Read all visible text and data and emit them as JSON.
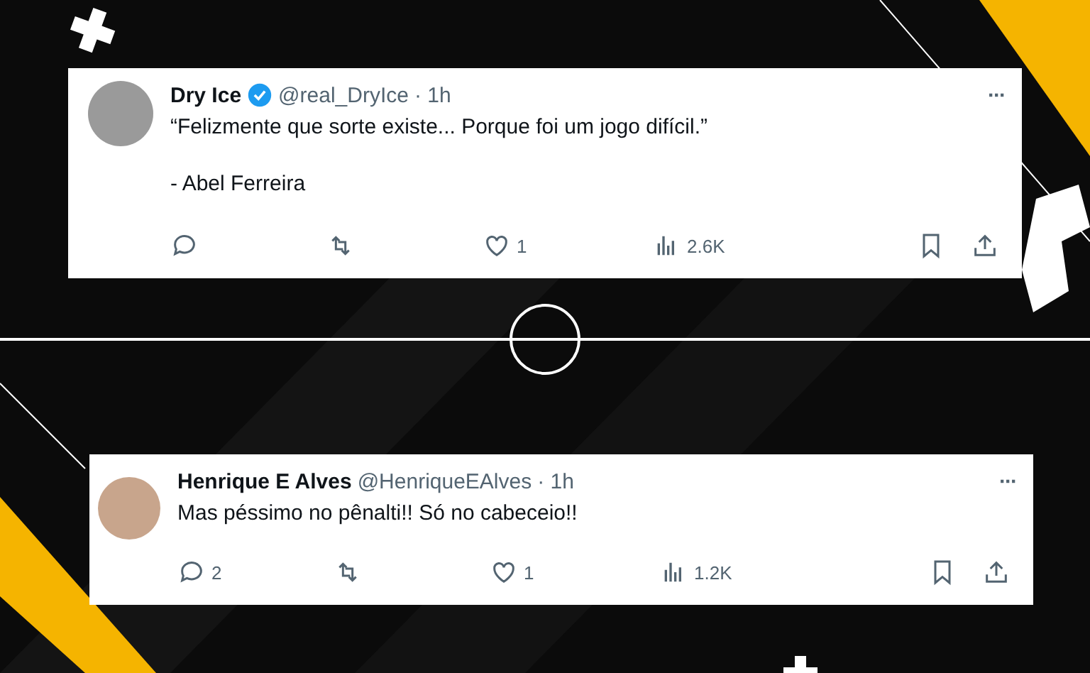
{
  "tweets": [
    {
      "name": "Dry Ice",
      "verified": true,
      "handle": "@real_DryIce",
      "time": "· 1h",
      "paragraphs": [
        "“Felizmente que sorte existe... Porque foi um jogo difícil.”",
        "- Abel Ferreira"
      ],
      "more": "···",
      "actions": [
        {
          "kind": "reply"
        },
        {
          "kind": "repost"
        },
        {
          "kind": "like",
          "count": "1"
        },
        {
          "kind": "views",
          "count": "2.6K"
        },
        {
          "kind": "bookmark"
        },
        {
          "kind": "share"
        }
      ]
    },
    {
      "name": "Henrique E Alves",
      "verified": false,
      "handle": "@HenriqueEAlves",
      "time": "· 1h",
      "paragraphs": [
        "Mas péssimo no pênalti!! Só no cabeceio!!"
      ],
      "more": "···",
      "actions": [
        {
          "kind": "reply",
          "count": "2"
        },
        {
          "kind": "repost"
        },
        {
          "kind": "like",
          "count": "1"
        },
        {
          "kind": "views",
          "count": "1.2K"
        },
        {
          "kind": "bookmark"
        },
        {
          "kind": "share"
        }
      ]
    }
  ]
}
